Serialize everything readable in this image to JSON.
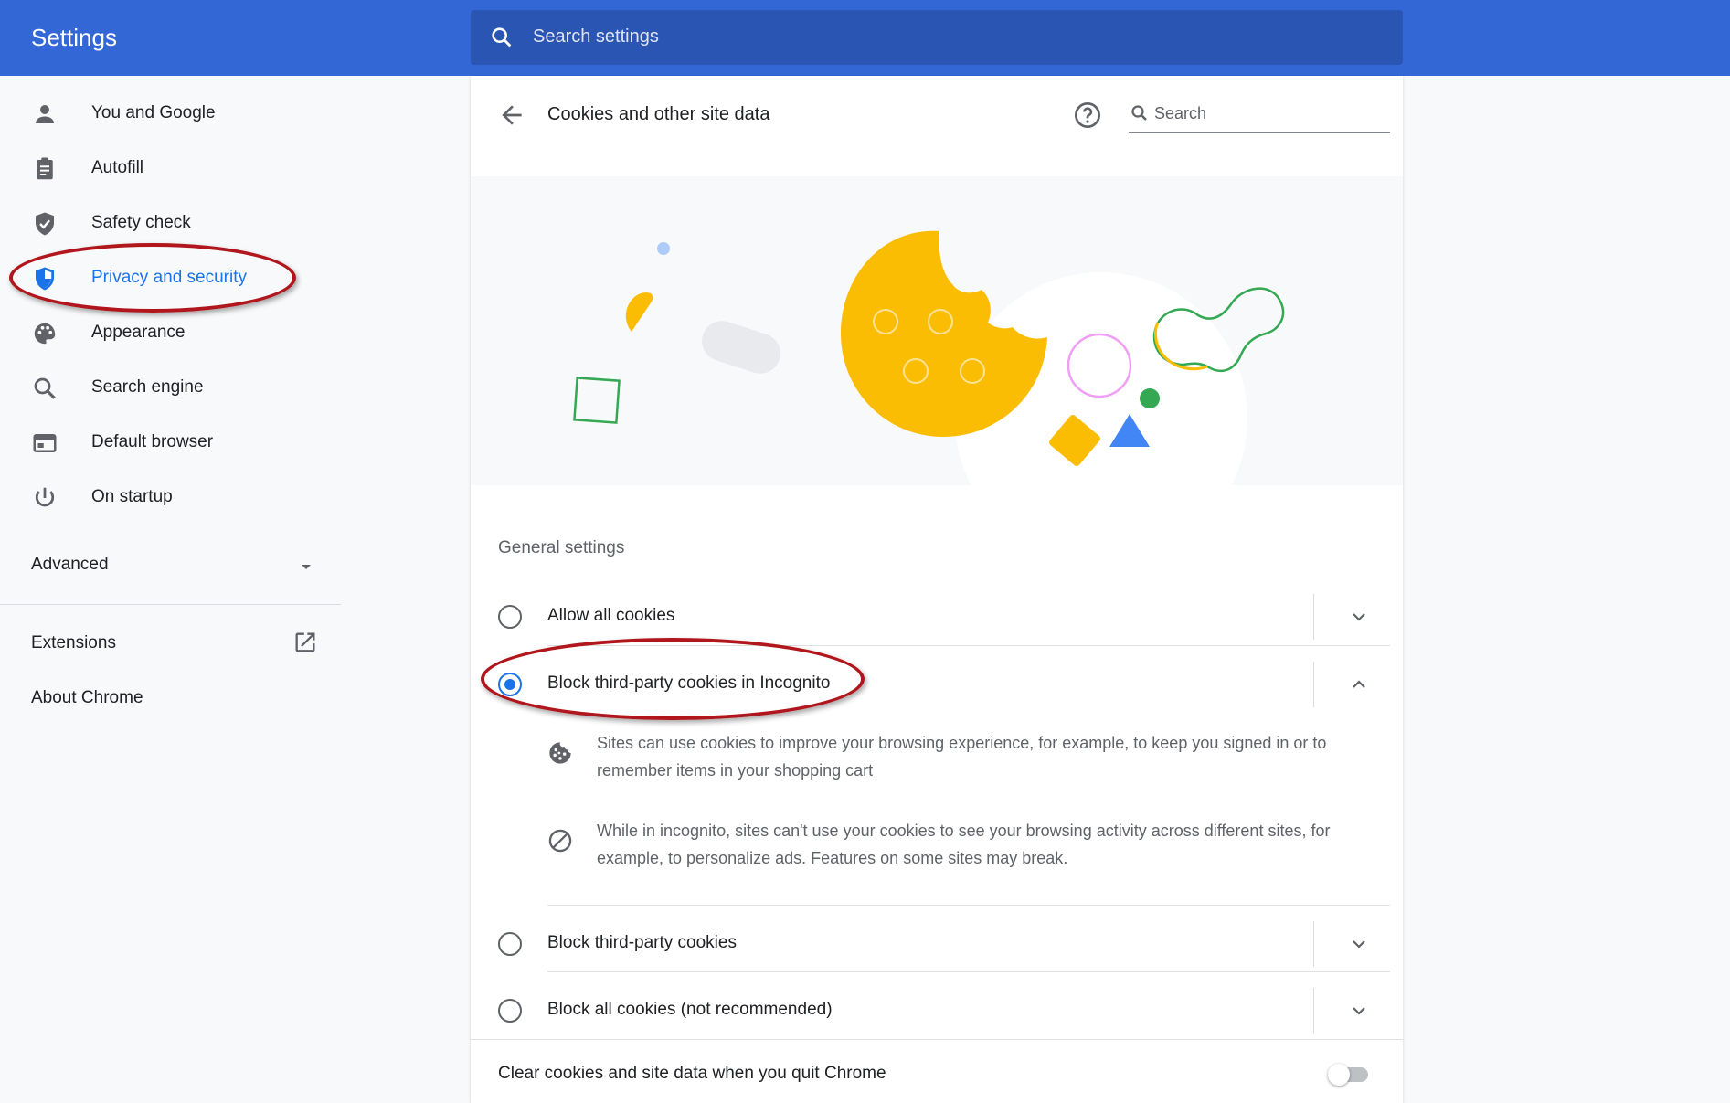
{
  "header": {
    "title": "Settings",
    "search_placeholder": "Search settings"
  },
  "sidebar": {
    "items": [
      {
        "label": "You and Google",
        "icon": "person-icon"
      },
      {
        "label": "Autofill",
        "icon": "clipboard-icon"
      },
      {
        "label": "Safety check",
        "icon": "shield-check-icon"
      },
      {
        "label": "Privacy and security",
        "icon": "shield-icon",
        "active": true
      },
      {
        "label": "Appearance",
        "icon": "palette-icon"
      },
      {
        "label": "Search engine",
        "icon": "search-icon"
      },
      {
        "label": "Default browser",
        "icon": "browser-window-icon"
      },
      {
        "label": "On startup",
        "icon": "power-icon"
      }
    ],
    "advanced_label": "Advanced",
    "extensions_label": "Extensions",
    "about_label": "About Chrome"
  },
  "page": {
    "title": "Cookies and other site data",
    "search_placeholder": "Search",
    "section_title": "General settings",
    "options": [
      {
        "label": "Allow all cookies",
        "selected": false
      },
      {
        "label": "Block third-party cookies in Incognito",
        "selected": true
      },
      {
        "label": "Block third-party cookies",
        "selected": false
      },
      {
        "label": "Block all cookies (not recommended)",
        "selected": false
      }
    ],
    "details": [
      {
        "icon": "cookie-icon",
        "text": "Sites can use cookies to improve your browsing experience, for example, to keep you signed in or to remember items in your shopping cart"
      },
      {
        "icon": "block-icon",
        "text": "While in incognito, sites can't use your cookies to see your browsing activity across different sites, for example, to personalize ads. Features on some sites may break."
      }
    ],
    "clear_on_quit_label": "Clear cookies and site data when you quit Chrome",
    "clear_on_quit_enabled": false
  },
  "colors": {
    "header_blue": "#3367d6",
    "accent_blue": "#1a73e8",
    "annotation_red": "#b0161c",
    "cookie_yellow": "#fbbc04"
  }
}
